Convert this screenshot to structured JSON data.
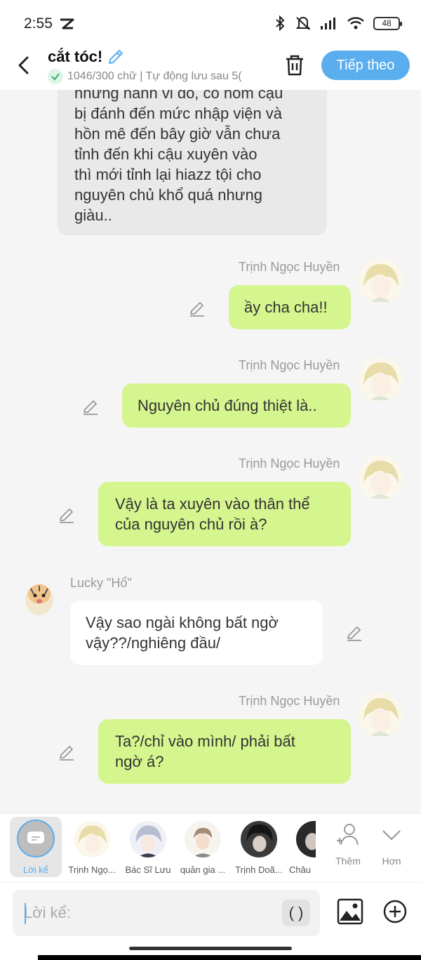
{
  "status_bar": {
    "time": "2:55",
    "battery": "48",
    "icons": [
      "capcut-icon",
      "bluetooth-icon",
      "mute-icon",
      "signal-icon",
      "wifi-icon",
      "battery-icon"
    ]
  },
  "header": {
    "title": "cắt tóc!",
    "subtitle": "1046/300 chữ | Tự động lưu sau 5(",
    "next_label": "Tiếp theo",
    "accent": "#5aaeee"
  },
  "messages": [
    {
      "type": "narration-gray",
      "text_lines": [
        "nhưng hành vi đó, có hôm cậu",
        "bị đánh đến mức nhập viện và",
        "hồn mê đến bây giờ vẫn chưa",
        "tỉnh đến khi cậu xuyên vào",
        "thì mới tỉnh lại hiazz tội cho",
        "nguyên chủ khổ quá nhưng",
        "giàu.."
      ]
    },
    {
      "sender": "Trịnh Ngọc Huyền",
      "text": "ầy cha cha!!"
    },
    {
      "sender": "Trịnh Ngọc Huyền",
      "text": "Nguyên chủ đúng thiệt là.."
    },
    {
      "sender": "Trịnh Ngọc Huyền",
      "text_lines": [
        "Vậy là ta xuyên vào thân thể",
        "của nguyên chủ rồi à?"
      ]
    },
    {
      "sender": "Lucky \"Hổ\"",
      "text_lines": [
        "Vậy sao ngài không bất ngờ",
        "vậy??/nghiêng đầu/"
      ]
    },
    {
      "sender": "Trịnh Ngọc Huyền",
      "text_lines": [
        "Ta?/chỉ vào mình/ phải bất",
        "ngờ á?"
      ]
    }
  ],
  "characters": [
    {
      "label": "Lời kể"
    },
    {
      "label": "Trịnh Ngọ..."
    },
    {
      "label": "Bác Sĩ Lưu"
    },
    {
      "label": "quản gia ..."
    },
    {
      "label": "Trịnh Doã..."
    },
    {
      "label": "Châu"
    }
  ],
  "actions": {
    "add_label": "Thêm",
    "more_label": "Hơn"
  },
  "input": {
    "placeholder": "Lời kể:",
    "paren_label": "( )"
  }
}
